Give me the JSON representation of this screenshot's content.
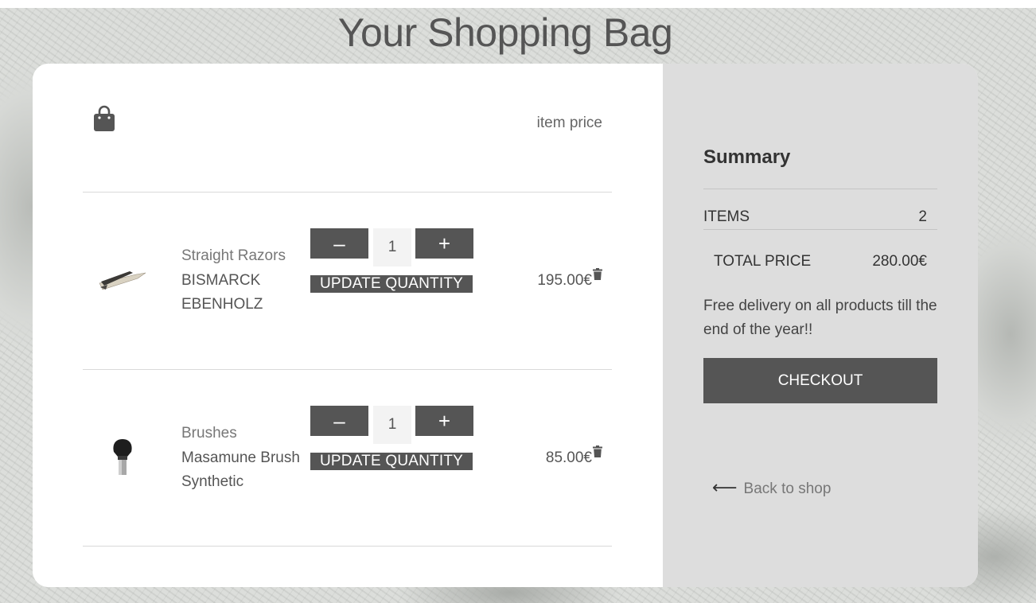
{
  "page": {
    "title": "Your Shopping Bag"
  },
  "bag": {
    "icon": "shopping-bag-icon",
    "price_column_label": "item price",
    "items": [
      {
        "category": "Straight Razors",
        "name": "BISMARCK EBENHOLZ",
        "quantity": "1",
        "decrease_label": "–",
        "increase_label": "+",
        "update_label": "UPDATE QUANTITY",
        "price": "195.00€",
        "image_icon": "straight-razor-image",
        "delete_icon": "trash-icon"
      },
      {
        "category": "Brushes",
        "name": "Masamune Brush Synthetic",
        "quantity": "1",
        "decrease_label": "–",
        "increase_label": "+",
        "update_label": "UPDATE QUANTITY",
        "price": "85.00€",
        "image_icon": "shaving-brush-image",
        "delete_icon": "trash-icon"
      }
    ]
  },
  "summary": {
    "title": "Summary",
    "items_label": "ITEMS",
    "items_value": "2",
    "total_label": "TOTAL PRICE",
    "total_value": "280.00€",
    "note": "Free delivery on all products till the end of the year!!",
    "checkout_label": "CHECKOUT",
    "back_arrow": "⟵",
    "back_label": "Back to shop"
  },
  "colors": {
    "accent": "#555555",
    "summary_bg": "#dddddd",
    "card_bg": "#ffffff"
  }
}
